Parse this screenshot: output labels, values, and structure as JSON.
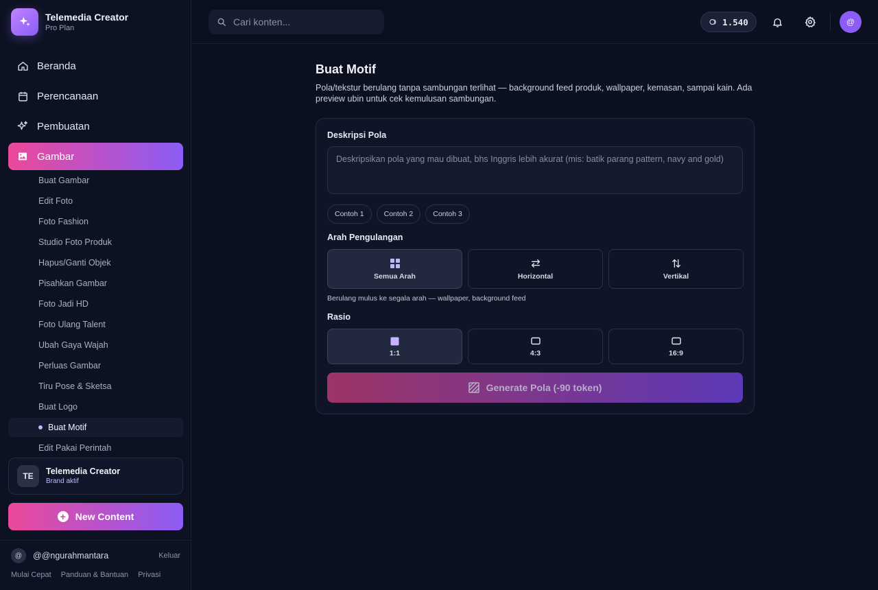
{
  "brand": {
    "title": "Telemedia Creator",
    "plan": "Pro Plan"
  },
  "nav": [
    {
      "label": "Beranda",
      "icon": "home-icon"
    },
    {
      "label": "Perencanaan",
      "icon": "calendar-icon"
    },
    {
      "label": "Pembuatan",
      "icon": "sparkle-icon"
    },
    {
      "label": "Gambar",
      "icon": "image-icon",
      "active": true
    }
  ],
  "subnav": [
    "Buat Gambar",
    "Edit Foto",
    "Foto Fashion",
    "Studio Foto Produk",
    "Hapus/Ganti Objek",
    "Pisahkan Gambar",
    "Foto Jadi HD",
    "Foto Ulang Talent",
    "Ubah Gaya Wajah",
    "Perluas Gambar",
    "Tiru Pose & Sketsa",
    "Buat Logo",
    "Buat Motif",
    "Edit Pakai Perintah"
  ],
  "subnav_active": "Buat Motif",
  "brand_card": {
    "initials": "TE",
    "name": "Telemedia Creator",
    "status": "Brand aktif"
  },
  "new_content_label": "New Content",
  "user": {
    "avatar": "@",
    "handle": "@@ngurahmantara",
    "logout": "Keluar"
  },
  "footer_links": [
    "Mulai Cepat",
    "Panduan & Bantuan",
    "Privasi"
  ],
  "topbar": {
    "search_placeholder": "Cari konten...",
    "tokens": "1.540",
    "avatar": "@"
  },
  "page": {
    "title": "Buat Motif",
    "description": "Pola/tekstur berulang tanpa sambungan terlihat — background feed produk, wallpaper, kemasan, sampai kain. Ada preview ubin untuk cek kemulusan sambungan."
  },
  "form": {
    "desc_label": "Deskripsi Pola",
    "desc_placeholder": "Deskripsikan pola yang mau dibuat, bhs Inggris lebih akurat (mis: batik parang pattern, navy and gold)",
    "desc_value": "",
    "examples": [
      "Contoh 1",
      "Contoh 2",
      "Contoh 3"
    ],
    "direction_label": "Arah Pengulangan",
    "directions": [
      {
        "label": "Semua Arah",
        "icon": "grid-icon",
        "selected": true
      },
      {
        "label": "Horizontal",
        "icon": "arrows-horizontal-icon",
        "selected": false
      },
      {
        "label": "Vertikal",
        "icon": "arrows-vertical-icon",
        "selected": false
      }
    ],
    "direction_hint": "Berulang mulus ke segala arah — wallpaper, background feed",
    "ratio_label": "Rasio",
    "ratios": [
      {
        "label": "1:1",
        "icon": "square-icon",
        "selected": true
      },
      {
        "label": "4:3",
        "icon": "rect-icon",
        "selected": false
      },
      {
        "label": "16:9",
        "icon": "rect-wide-icon",
        "selected": false
      }
    ],
    "generate_label": "Generate Pola (-90 token)"
  },
  "colors": {
    "background": "#0b1020",
    "accent_pink": "#ec4899",
    "accent_purple": "#8b5cf6"
  }
}
